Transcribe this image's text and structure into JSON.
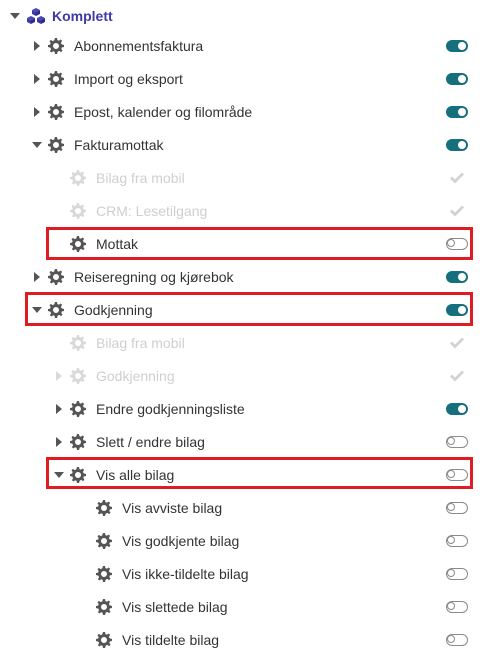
{
  "root": {
    "label": "Komplett"
  },
  "items": [
    {
      "label": "Abonnementsfaktura",
      "state": "on"
    },
    {
      "label": "Import og eksport",
      "state": "on"
    },
    {
      "label": "Epost, kalender og filområde",
      "state": "on"
    },
    {
      "label": "Fakturamottak",
      "state": "on"
    },
    {
      "label": "Bilag fra mobil",
      "state": "check"
    },
    {
      "label": "CRM: Lesetilgang",
      "state": "check"
    },
    {
      "label": "Mottak",
      "state": "off"
    },
    {
      "label": "Reiseregning og kjørebok",
      "state": "on"
    },
    {
      "label": "Godkjenning",
      "state": "on"
    },
    {
      "label": "Bilag fra mobil",
      "state": "check"
    },
    {
      "label": "Godkjenning",
      "state": "check"
    },
    {
      "label": "Endre godkjenningsliste",
      "state": "on"
    },
    {
      "label": "Slett / endre bilag",
      "state": "off"
    },
    {
      "label": "Vis alle bilag",
      "state": "off"
    },
    {
      "label": "Vis avviste bilag",
      "state": "off"
    },
    {
      "label": "Vis godkjente bilag",
      "state": "off"
    },
    {
      "label": "Vis ikke-tildelte bilag",
      "state": "off"
    },
    {
      "label": "Vis slettede bilag",
      "state": "off"
    },
    {
      "label": "Vis tildelte bilag",
      "state": "off"
    }
  ],
  "colors": {
    "toggle_on": "#156f7c",
    "root_text": "#3d3aa8",
    "highlight": "#e11b22"
  }
}
